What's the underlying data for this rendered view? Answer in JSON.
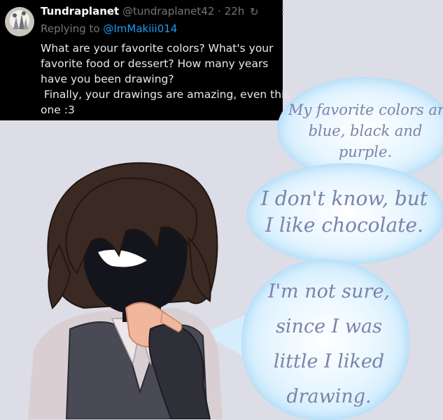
{
  "tweet": {
    "display_name": "Tundraplanet",
    "handle": "@tundraplanet42",
    "separator": "·",
    "time": "22h",
    "sync_icon": "sync-icon",
    "more_icon": "more-icon",
    "reply_prefix": "Replying to ",
    "reply_mention": "@ImMakiii014",
    "body_lines": [
      "What are your favorite colors? What's your",
      "favorite food or dessert? How many years",
      "have you been drawing?",
      " Finally, your drawings are amazing, even this",
      "one :3"
    ]
  },
  "bubbles": {
    "colors": "My favorite colors are\nblue, black and\npurple.",
    "food": "I don't know, but\nI like chocolate.",
    "drawing": "I'm not sure,\nsince I was\nlittle I liked\ndrawing."
  },
  "palette": {
    "background": "#dcdde6",
    "hair": "#3b2a24",
    "face": "#14141c",
    "skin": "#f1b79c",
    "vest": "#4a4a56",
    "shirt": "#d9cfd3",
    "bubble_edge": "#9fd3f3"
  }
}
